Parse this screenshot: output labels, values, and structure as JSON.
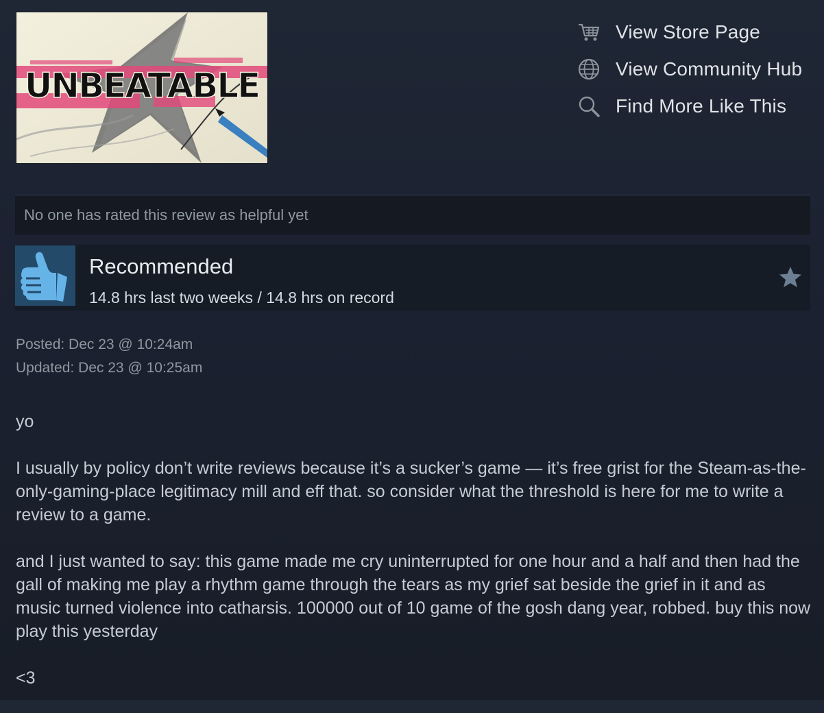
{
  "game": {
    "capsule_logo_text": "UNBEATABLE"
  },
  "links": [
    {
      "label": "View Store Page",
      "icon": "shopping-cart-icon"
    },
    {
      "label": "View Community Hub",
      "icon": "globe-icon"
    },
    {
      "label": "Find More Like This",
      "icon": "magnifier-icon"
    }
  ],
  "helpful": {
    "text": "No one has rated this review as helpful yet"
  },
  "recommendation": {
    "title": "Recommended",
    "hours": "14.8 hrs last two weeks / 14.8 hrs on record",
    "thumb_icon": "thumbs-up-icon",
    "award_icon": "star-icon"
  },
  "dates": {
    "posted": "Posted: Dec 23 @ 10:24am",
    "updated": "Updated: Dec 23 @ 10:25am"
  },
  "review": {
    "paragraphs": [
      "yo",
      "I usually by policy don’t write reviews because it’s a sucker’s game — it’s free grist for the Steam-as-the-only-gaming-place legitimacy mill and eff that. so consider what the threshold is here for me to write a review to a game.",
      "and I just wanted to say: this game made me cry uninterrupted for one hour and a half and then had the gall of making me play a rhythm game through the tears as my grief sat beside the grief in it and as music turned violence into catharsis. 100000 out of 10 game of the gosh dang year, robbed. buy this now play this yesterday",
      "<3"
    ]
  },
  "colors": {
    "background": "#1b2130",
    "thumb_box": "#244a6a",
    "thumb": "#66b3e8",
    "muted_text": "#8f98a0",
    "logo_pink": "#e2497a"
  }
}
